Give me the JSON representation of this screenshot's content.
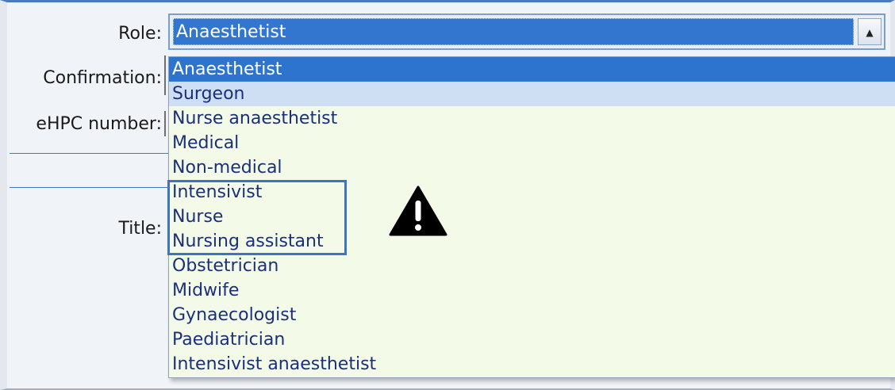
{
  "form": {
    "role_label": "Role:",
    "confirmation_label": "Confirmation:",
    "ehpc_label": "eHPC number:",
    "title_label": "Title:"
  },
  "role_select": {
    "value": "Anaesthetist",
    "button_glyph": "▲"
  },
  "dropdown": {
    "options": [
      "Anaesthetist",
      "Surgeon",
      "Nurse anaesthetist",
      "Medical",
      "Non-medical",
      "Intensivist",
      "Nurse",
      "Nursing assistant",
      "Obstetrician",
      "Midwife",
      "Gynaecologist",
      "Paediatrician",
      "Intensivist anaesthetist"
    ],
    "selected": "Anaesthetist",
    "hovered": "Surgeon"
  },
  "annotation": {
    "highlighted_options": [
      "Intensivist",
      "Nurse",
      "Nursing assistant"
    ],
    "icon": "warning-triangle-icon"
  },
  "colors": {
    "selection": "#2d74cf",
    "hover": "#cfdff3",
    "list_background": "#f3fbe8",
    "list_text": "#1b2f7a",
    "annotation_border": "#3d73bf"
  }
}
